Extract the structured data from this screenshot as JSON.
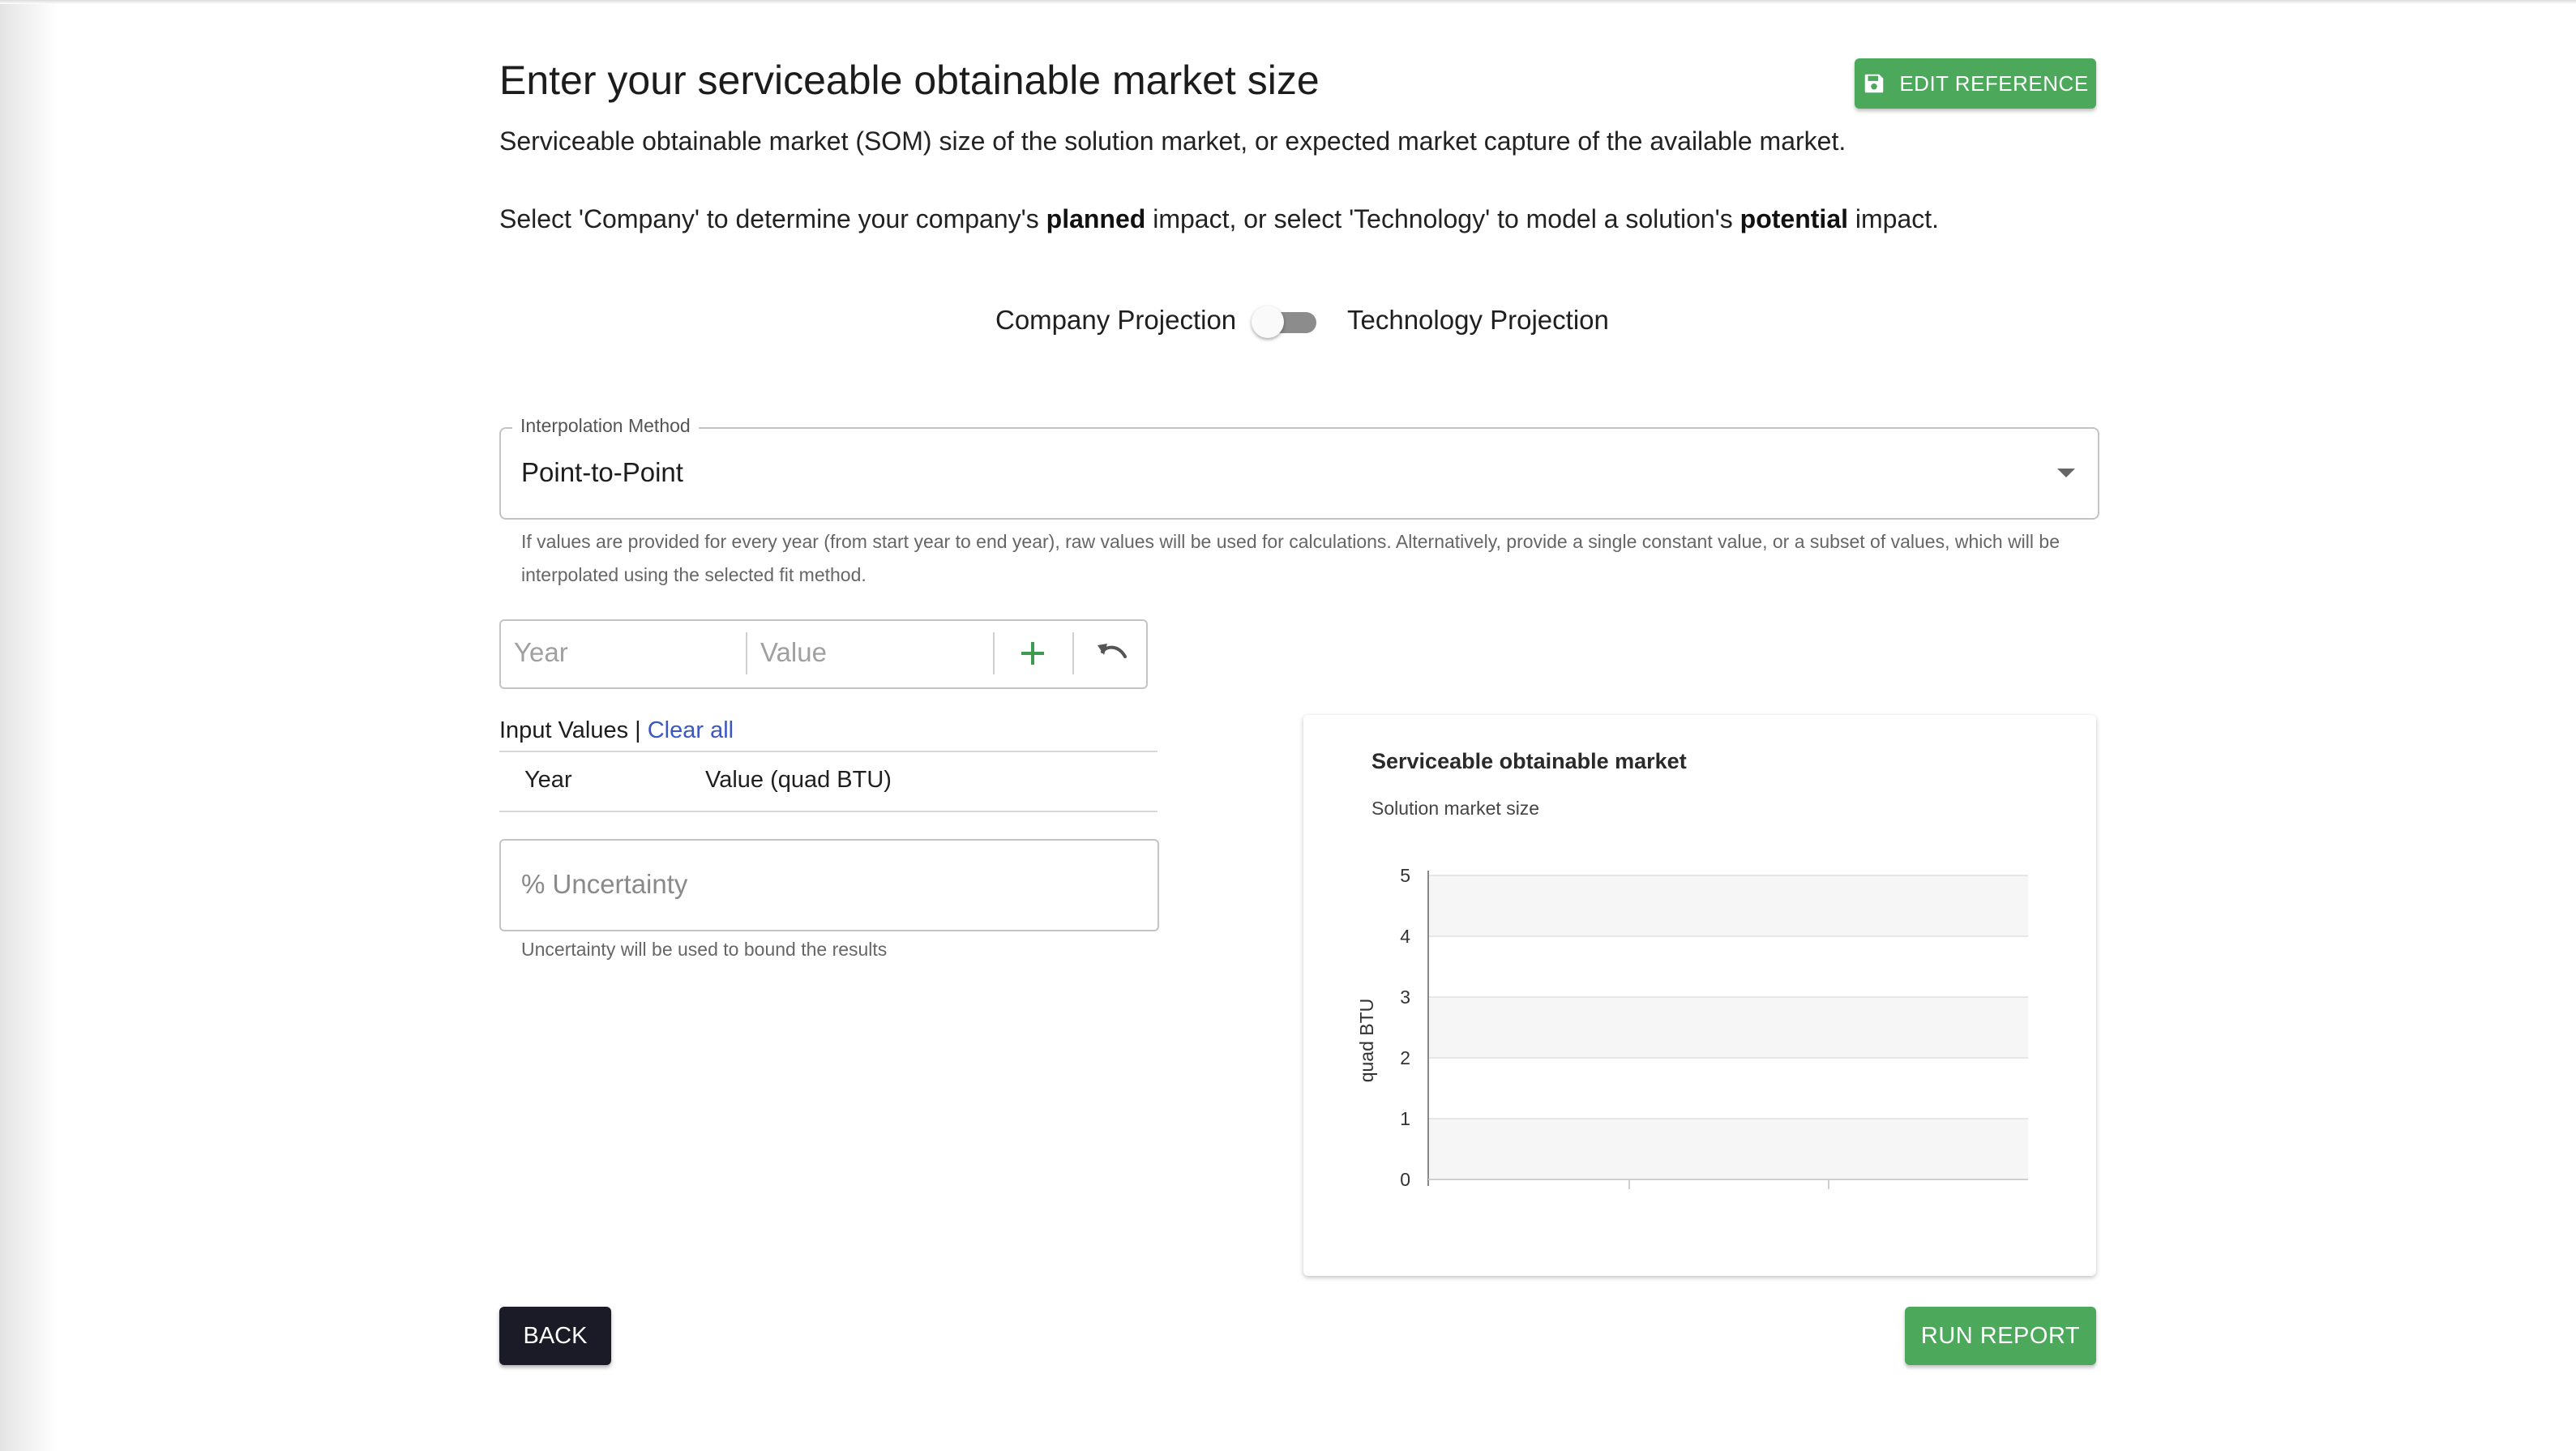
{
  "header": {
    "title": "Enter your serviceable obtainable market size",
    "edit_reference_label": "EDIT REFERENCE",
    "description": "Serviceable obtainable market (SOM) size of the solution market, or expected market capture of the available market.",
    "select_text": {
      "part1": "Select 'Company' to determine your company's ",
      "bold1": "planned",
      "part2": " impact, or select 'Technology' to model a solution's ",
      "bold2": "potential",
      "part3": " impact."
    }
  },
  "projection_toggle": {
    "left_label": "Company Projection",
    "right_label": "Technology Projection",
    "checked": false
  },
  "interpolation": {
    "legend": "Interpolation Method",
    "selected": "Point-to-Point",
    "helper": "If values are provided for every year (from start year to end year), raw values will be used for calculations. Alternatively, provide a single constant value, or a subset of values, which will be interpolated using the selected fit method."
  },
  "entry": {
    "year_placeholder": "Year",
    "value_placeholder": "Value",
    "add_icon": "plus-icon",
    "undo_icon": "undo-icon"
  },
  "input_values": {
    "label": "Input Values | ",
    "clear_all": "Clear all",
    "columns": [
      "Year",
      "Value (quad BTU)"
    ],
    "rows": []
  },
  "uncertainty": {
    "placeholder": "% Uncertainty",
    "helper": "Uncertainty will be used to bound the results"
  },
  "chart_data": {
    "type": "line",
    "title": "Serviceable obtainable market",
    "subtitle": "Solution market size",
    "xlabel": "",
    "ylabel": "quad BTU",
    "ylim": [
      0,
      5
    ],
    "yticks": [
      "0",
      "1",
      "2",
      "3",
      "4",
      "5"
    ],
    "series": [],
    "grid": "horizontal bands"
  },
  "footer": {
    "back_label": "BACK",
    "run_report_label": "RUN REPORT"
  },
  "colors": {
    "accent_green": "#4ca85a",
    "back_button": "#1b1b27",
    "link_blue": "#3a57c4"
  }
}
